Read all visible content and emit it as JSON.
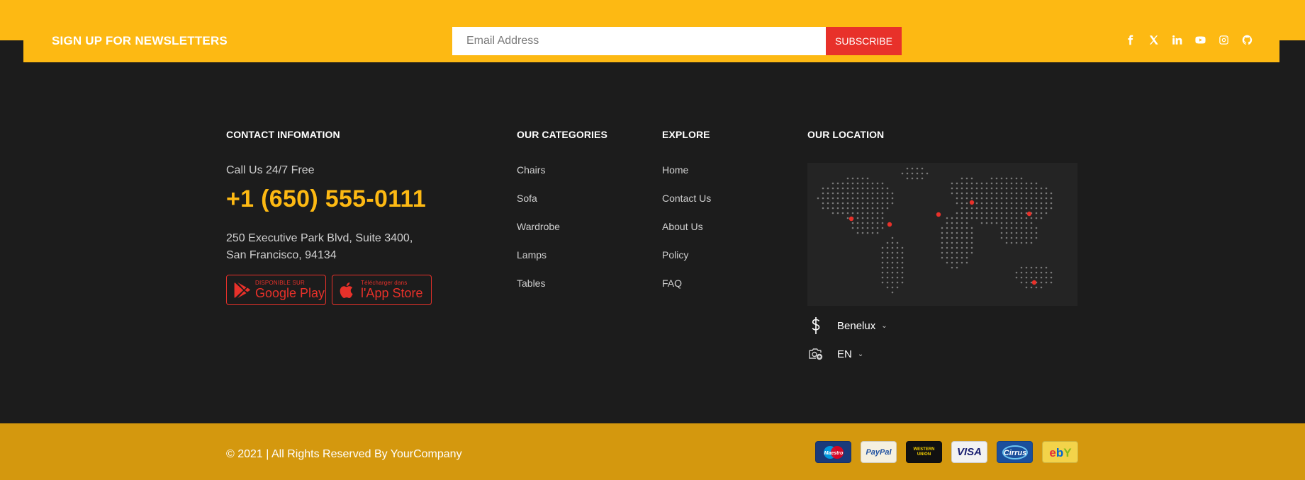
{
  "newsletter": {
    "title": "SIGN UP FOR NEWSLETTERS",
    "email_placeholder": "Email Address",
    "subscribe_label": "SUBSCRIBE",
    "socials": [
      "facebook-icon",
      "x-icon",
      "linkedin-icon",
      "youtube-icon",
      "instagram-icon",
      "github-icon"
    ]
  },
  "contact": {
    "heading": "CONTACT INFOMATION",
    "call_label": "Call Us 24/7 Free",
    "phone": "+1 (650) 555-0111",
    "address_line1": "250 Executive Park Blvd, Suite 3400,",
    "address_line2": "San Francisco, 94134",
    "google_play": {
      "small": "DISPONIBLE SUR",
      "big": "Google Play"
    },
    "app_store": {
      "small": "Télécharger dans",
      "big": "l'App Store"
    }
  },
  "categories": {
    "heading": "OUR CATEGORIES",
    "items": [
      "Chairs",
      "Sofa",
      "Wardrobe",
      "Lamps",
      "Tables"
    ]
  },
  "explore": {
    "heading": "EXPLORE",
    "items": [
      "Home",
      "Contact Us",
      "About Us",
      "Policy",
      "FAQ"
    ]
  },
  "location": {
    "heading": "OUR LOCATION",
    "currency": "Benelux",
    "language": "EN"
  },
  "footer": {
    "copyright": "© 2021 | All Rights Reserved By YourCompany",
    "payments": [
      "Maestro",
      "PayPal",
      "WESTERN UNION",
      "VISA",
      "Cirrus",
      "ebY"
    ]
  },
  "colors": {
    "accent": "#fdb913",
    "bottom_bar": "#d4980e",
    "subscribe": "#e8312a",
    "background": "#1c1c1c"
  }
}
